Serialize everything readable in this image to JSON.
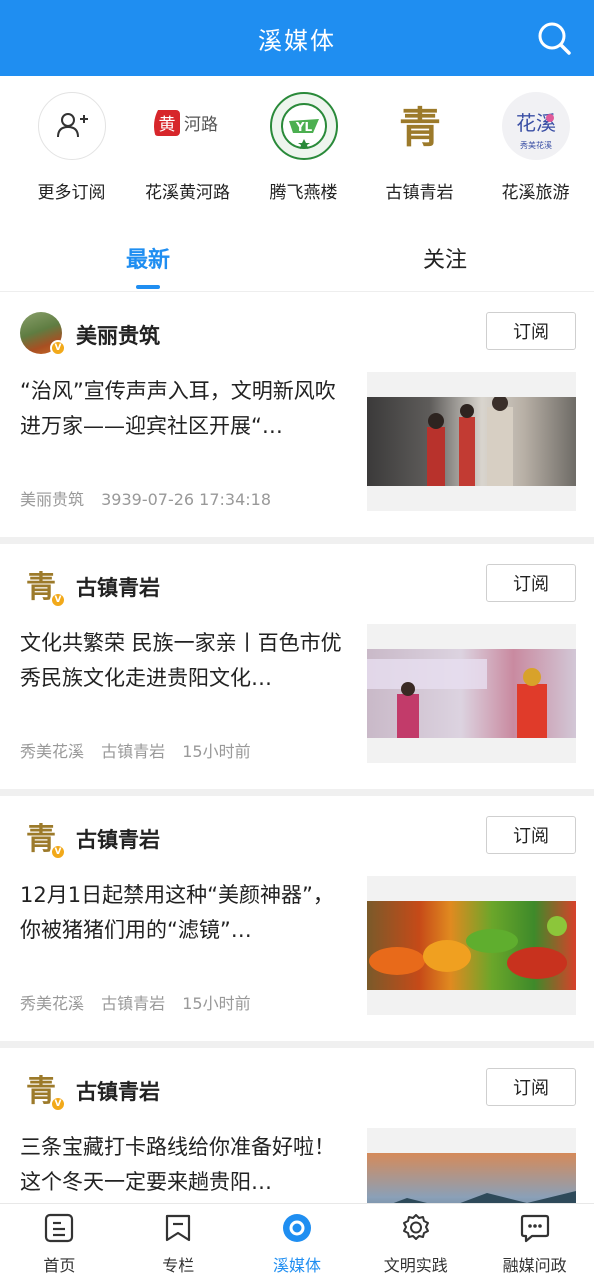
{
  "header": {
    "title": "溪媒体",
    "search_icon": "search-icon"
  },
  "subscriptions": [
    {
      "label": "更多订阅",
      "icon": "add-user-icon"
    },
    {
      "label": "花溪黄河路",
      "logo_text": "黄河路"
    },
    {
      "label": "腾飞燕楼",
      "logo_text": "YL"
    },
    {
      "label": "古镇青岩",
      "logo_text": "青岩"
    },
    {
      "label": "花溪旅游",
      "logo_text": "花溪"
    }
  ],
  "tabs": {
    "latest": "最新",
    "follow": "关注"
  },
  "subscribe_label": "订阅",
  "feed": [
    {
      "source": "美丽贵筑",
      "headline": "“治风”宣传声声入耳，文明新风吹进万家——迎宾社区开展“…",
      "meta": [
        "美丽贵筑",
        "3939-07-26 17:34:18"
      ]
    },
    {
      "source": "古镇青岩",
      "headline": "文化共繁荣 民族一家亲丨百色市优秀民族文化走进贵阳文化…",
      "meta": [
        "秀美花溪",
        "古镇青岩",
        "15小时前"
      ]
    },
    {
      "source": "古镇青岩",
      "headline": "12月1日起禁用这种“美颜神器”，你被猪猪们用的“滤镜”…",
      "meta": [
        "秀美花溪",
        "古镇青岩",
        "15小时前"
      ]
    },
    {
      "source": "古镇青岩",
      "headline": "三条宝藏打卡路线给你准备好啦！这个冬天一定要来趟贵阳…",
      "meta": []
    }
  ],
  "bottom_nav": [
    {
      "label": "首页",
      "icon": "home-icon"
    },
    {
      "label": "专栏",
      "icon": "bookmark-icon"
    },
    {
      "label": "溪媒体",
      "icon": "media-icon",
      "active": true
    },
    {
      "label": "文明实践",
      "icon": "gear-icon"
    },
    {
      "label": "融媒问政",
      "icon": "chat-icon"
    }
  ],
  "colors": {
    "brand": "#1f8ef1",
    "badge": "#f2a91a"
  }
}
